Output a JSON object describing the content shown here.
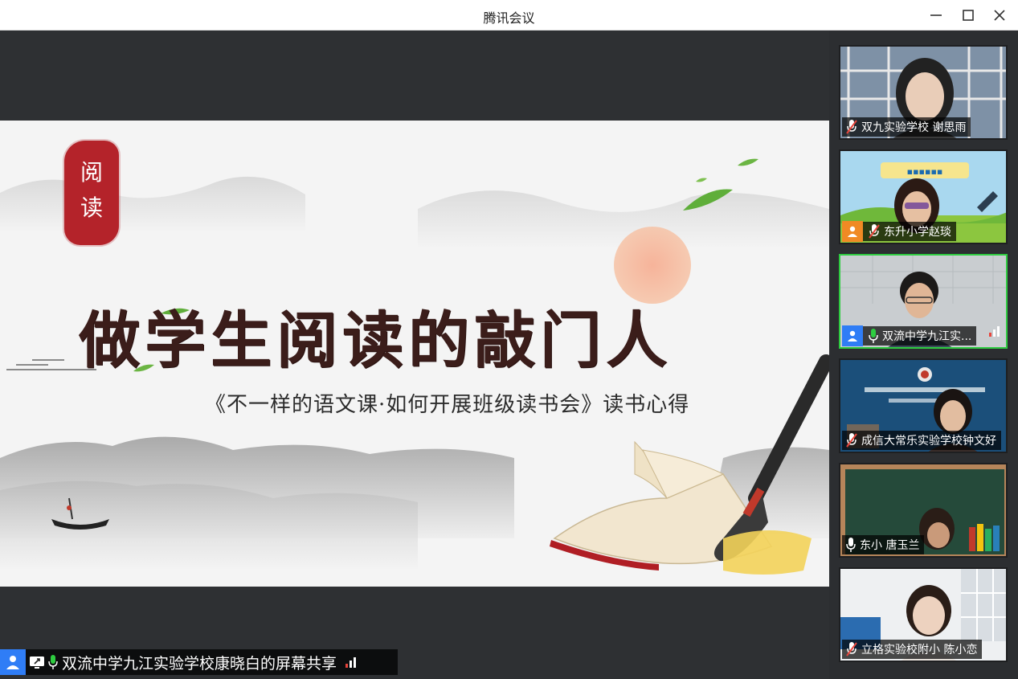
{
  "window": {
    "title": "腾讯会议",
    "controls": [
      "minimize",
      "maximize",
      "close"
    ]
  },
  "slide": {
    "seal_text": [
      "阅",
      "读"
    ],
    "main_title": "做学生阅读的敲门人",
    "subtitle": "《不一样的语文课·如何开展班级读书会》读书心得"
  },
  "share_bar": {
    "label": "双流中学九江实验学校康晓白的屏幕共享"
  },
  "participants": [
    {
      "name": "双九实验学校 谢思雨",
      "mic": "muted",
      "avatar": false
    },
    {
      "name": "东升小学赵琰",
      "mic": "muted",
      "avatar": true,
      "avatar_color": "#f08a24"
    },
    {
      "name": "双流中学九江实...",
      "mic": "on",
      "avatar": true,
      "avatar_color": "#2f7df6",
      "active": true
    },
    {
      "name": "成信大常乐实验学校钟文好",
      "mic": "muted",
      "avatar": false
    },
    {
      "name": "东小  唐玉兰",
      "mic": "on-idle",
      "avatar": false
    },
    {
      "name": "立格实验校附小 陈小恋",
      "mic": "muted",
      "avatar": false
    }
  ],
  "colors": {
    "accent_blue": "#2f7df6",
    "active_green": "#2ecc40",
    "seal_red": "#b4232a",
    "signal_red": "#e8453c"
  }
}
